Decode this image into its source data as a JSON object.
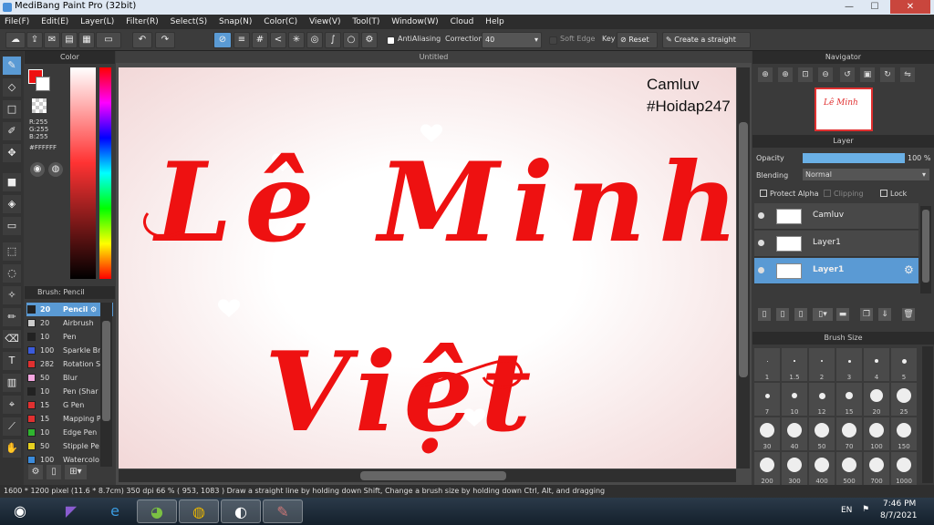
{
  "window": {
    "title": "MediBang Paint Pro (32bit)",
    "min": "—",
    "max": "☐",
    "close": "✕"
  },
  "menu": [
    "File(F)",
    "Edit(E)",
    "Layer(L)",
    "Filter(R)",
    "Select(S)",
    "Snap(N)",
    "Color(C)",
    "View(V)",
    "Tool(T)",
    "Window(W)",
    "Cloud",
    "Help"
  ],
  "toolbar": {
    "antialiasing_label": "AntiAliasing",
    "correction_label": "Correction",
    "correction_value": "40",
    "soft_edge_label": "Soft Edge",
    "key_label": "Key",
    "reset_label": "Reset",
    "straight_line_label": "Create a straight line"
  },
  "color_panel": {
    "title": "Color",
    "r": "R:255",
    "g": "G:255",
    "b": "B:255",
    "hex": "#FFFFFF"
  },
  "brush_panel": {
    "title": "Brush: Pencil",
    "items": [
      {
        "size": "20",
        "name": "Pencil",
        "color": "#222222"
      },
      {
        "size": "20",
        "name": "Airbrush",
        "color": "#cccccc"
      },
      {
        "size": "10",
        "name": "Pen",
        "color": "#222222"
      },
      {
        "size": "100",
        "name": "Sparkle Br",
        "color": "#3b5bdb"
      },
      {
        "size": "282",
        "name": "Rotation S",
        "color": "#e03030"
      },
      {
        "size": "50",
        "name": "Blur",
        "color": "#f4a6e0"
      },
      {
        "size": "10",
        "name": "Pen (Shar",
        "color": "#222222"
      },
      {
        "size": "15",
        "name": "G Pen",
        "color": "#e03030"
      },
      {
        "size": "15",
        "name": "Mapping P",
        "color": "#e03030"
      },
      {
        "size": "10",
        "name": "Edge Pen",
        "color": "#2fb52f"
      },
      {
        "size": "50",
        "name": "Stipple Pe",
        "color": "#e6d020"
      },
      {
        "size": "100",
        "name": "Watercolo",
        "color": "#3b8bdb"
      }
    ]
  },
  "document": {
    "tab_title": "Untitled"
  },
  "artwork": {
    "watermark_line1": "Camluv",
    "watermark_line2": "#Hoidap247",
    "line1": "Lê Minh",
    "line2": "Việt",
    "ink_color": "#ee1111"
  },
  "navigator": {
    "title": "Navigator"
  },
  "layer_panel": {
    "title": "Layer",
    "opacity_label": "Opacity",
    "opacity_value": "100 %",
    "opacity_percent": 100,
    "blending_label": "Blending",
    "blending_value": "Normal",
    "protect_alpha_label": "Protect Alpha",
    "clipping_label": "Clipping",
    "lock_label": "Lock",
    "layers": [
      {
        "name": "Camluv"
      },
      {
        "name": "Layer1"
      },
      {
        "name": "Layer1"
      }
    ]
  },
  "brush_size_panel": {
    "title": "Brush Size",
    "sizes": [
      "1",
      "1.5",
      "2",
      "3",
      "4",
      "5",
      "7",
      "10",
      "12",
      "15",
      "20",
      "25",
      "30",
      "40",
      "50",
      "70",
      "100",
      "150",
      "200",
      "300",
      "400",
      "500",
      "700",
      "1000"
    ]
  },
  "status": {
    "text": "1600 * 1200 pixel   (11.6 * 8.7cm)   350 dpi   66 %   ( 953, 1083 )   Draw a straight line by holding down Shift, Change a brush size by holding down Ctrl, Alt, and dragging"
  },
  "taskbar": {
    "lang": "EN",
    "time": "7:46 PM",
    "date": "8/7/2021"
  }
}
